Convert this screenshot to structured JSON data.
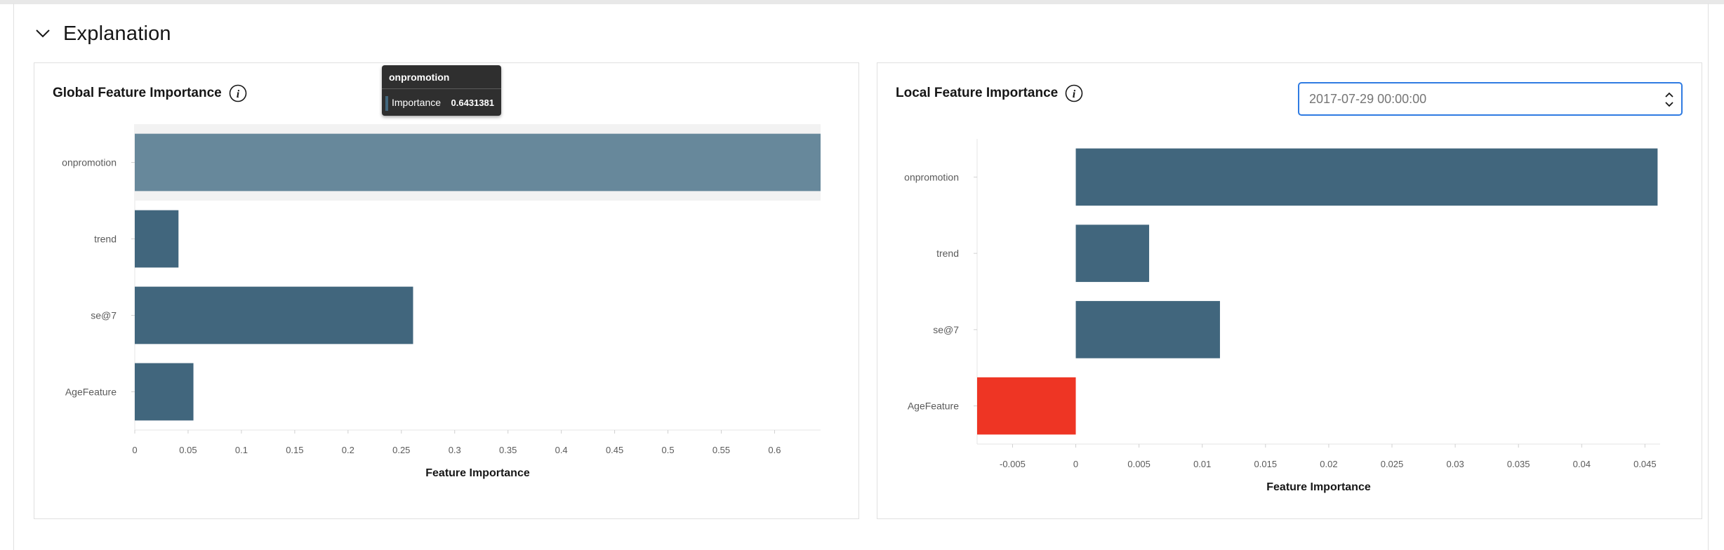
{
  "section": {
    "title": "Explanation"
  },
  "global": {
    "title": "Global Feature Importance"
  },
  "local": {
    "title": "Local Feature Importance",
    "date_value": "2017-07-29 00:00:00"
  },
  "tooltip": {
    "title": "onpromotion",
    "label": "Importance",
    "value": "0.6431381"
  },
  "colors": {
    "bar": "#41667d",
    "highlight": "#67889b",
    "negative": "#ee3524",
    "accent": "#2f7be2"
  },
  "icons": [
    "chevron-down-icon",
    "info-icon",
    "select-arrows-icon"
  ],
  "chart_data": [
    {
      "type": "bar",
      "orientation": "horizontal",
      "title": "Global Feature Importance",
      "categories": [
        "onpromotion",
        "trend",
        "se@7",
        "AgeFeature"
      ],
      "values": [
        0.6431381,
        0.041,
        0.261,
        0.055
      ],
      "xlabel": "Feature Importance",
      "xlim": [
        0,
        0.6431381
      ],
      "xticks": [
        0,
        0.05,
        0.1,
        0.15,
        0.2,
        0.25,
        0.3,
        0.35,
        0.4,
        0.45,
        0.5,
        0.55,
        0.6
      ],
      "highlighted": "onpromotion"
    },
    {
      "type": "bar",
      "orientation": "horizontal",
      "title": "Local Feature Importance",
      "categories": [
        "onpromotion",
        "trend",
        "se@7",
        "AgeFeature"
      ],
      "values": [
        0.046,
        0.0058,
        0.0114,
        -0.0078
      ],
      "xlabel": "Feature Importance",
      "xlim": [
        -0.0078,
        0.0462
      ],
      "xticks": [
        -0.005,
        0,
        0.005,
        0.01,
        0.015,
        0.02,
        0.025,
        0.03,
        0.035,
        0.04,
        0.045
      ]
    }
  ]
}
